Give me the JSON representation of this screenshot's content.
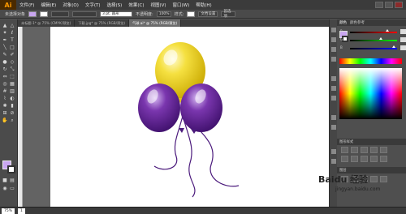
{
  "app": {
    "logo": "Ai"
  },
  "menu": [
    "文件(F)",
    "编辑(E)",
    "对象(O)",
    "文字(T)",
    "选择(S)",
    "效果(C)",
    "视图(V)",
    "窗口(W)",
    "帮助(H)"
  ],
  "control_bar": {
    "selection_label": "未选择对象",
    "fill_color": "#c9a6f0",
    "stroke_color": "#ffffff",
    "brush_label": "3 pt. 圆形",
    "opacity_label": "不透明度:",
    "opacity_value": "100%",
    "style_label": "样式:",
    "doc_setup_label": "文档设置",
    "prefs_label": "首选项"
  },
  "doc_tabs": [
    {
      "label": "未标题-1* @ 75% (CMYK/预览)",
      "active": false
    },
    {
      "label": "下载.jpg* @ 75% (RGB/预览)",
      "active": false
    },
    {
      "label": "气球.ai* @ 75% (RGB/预览)",
      "active": true
    }
  ],
  "right_panel": {
    "tabs": [
      "颜色",
      "颜色参考"
    ],
    "channels": [
      "R",
      "G",
      "B"
    ],
    "section_1": "图形样式",
    "section_2": "图层"
  },
  "status": {
    "zoom": "75%",
    "page": "1"
  },
  "balloons": {
    "yellow": "#f3d62c",
    "purple": "#5f1f92",
    "string": "#4b1a7c"
  },
  "watermark": {
    "text": "Baidu 经验",
    "url": "jingyan.baidu.com"
  }
}
